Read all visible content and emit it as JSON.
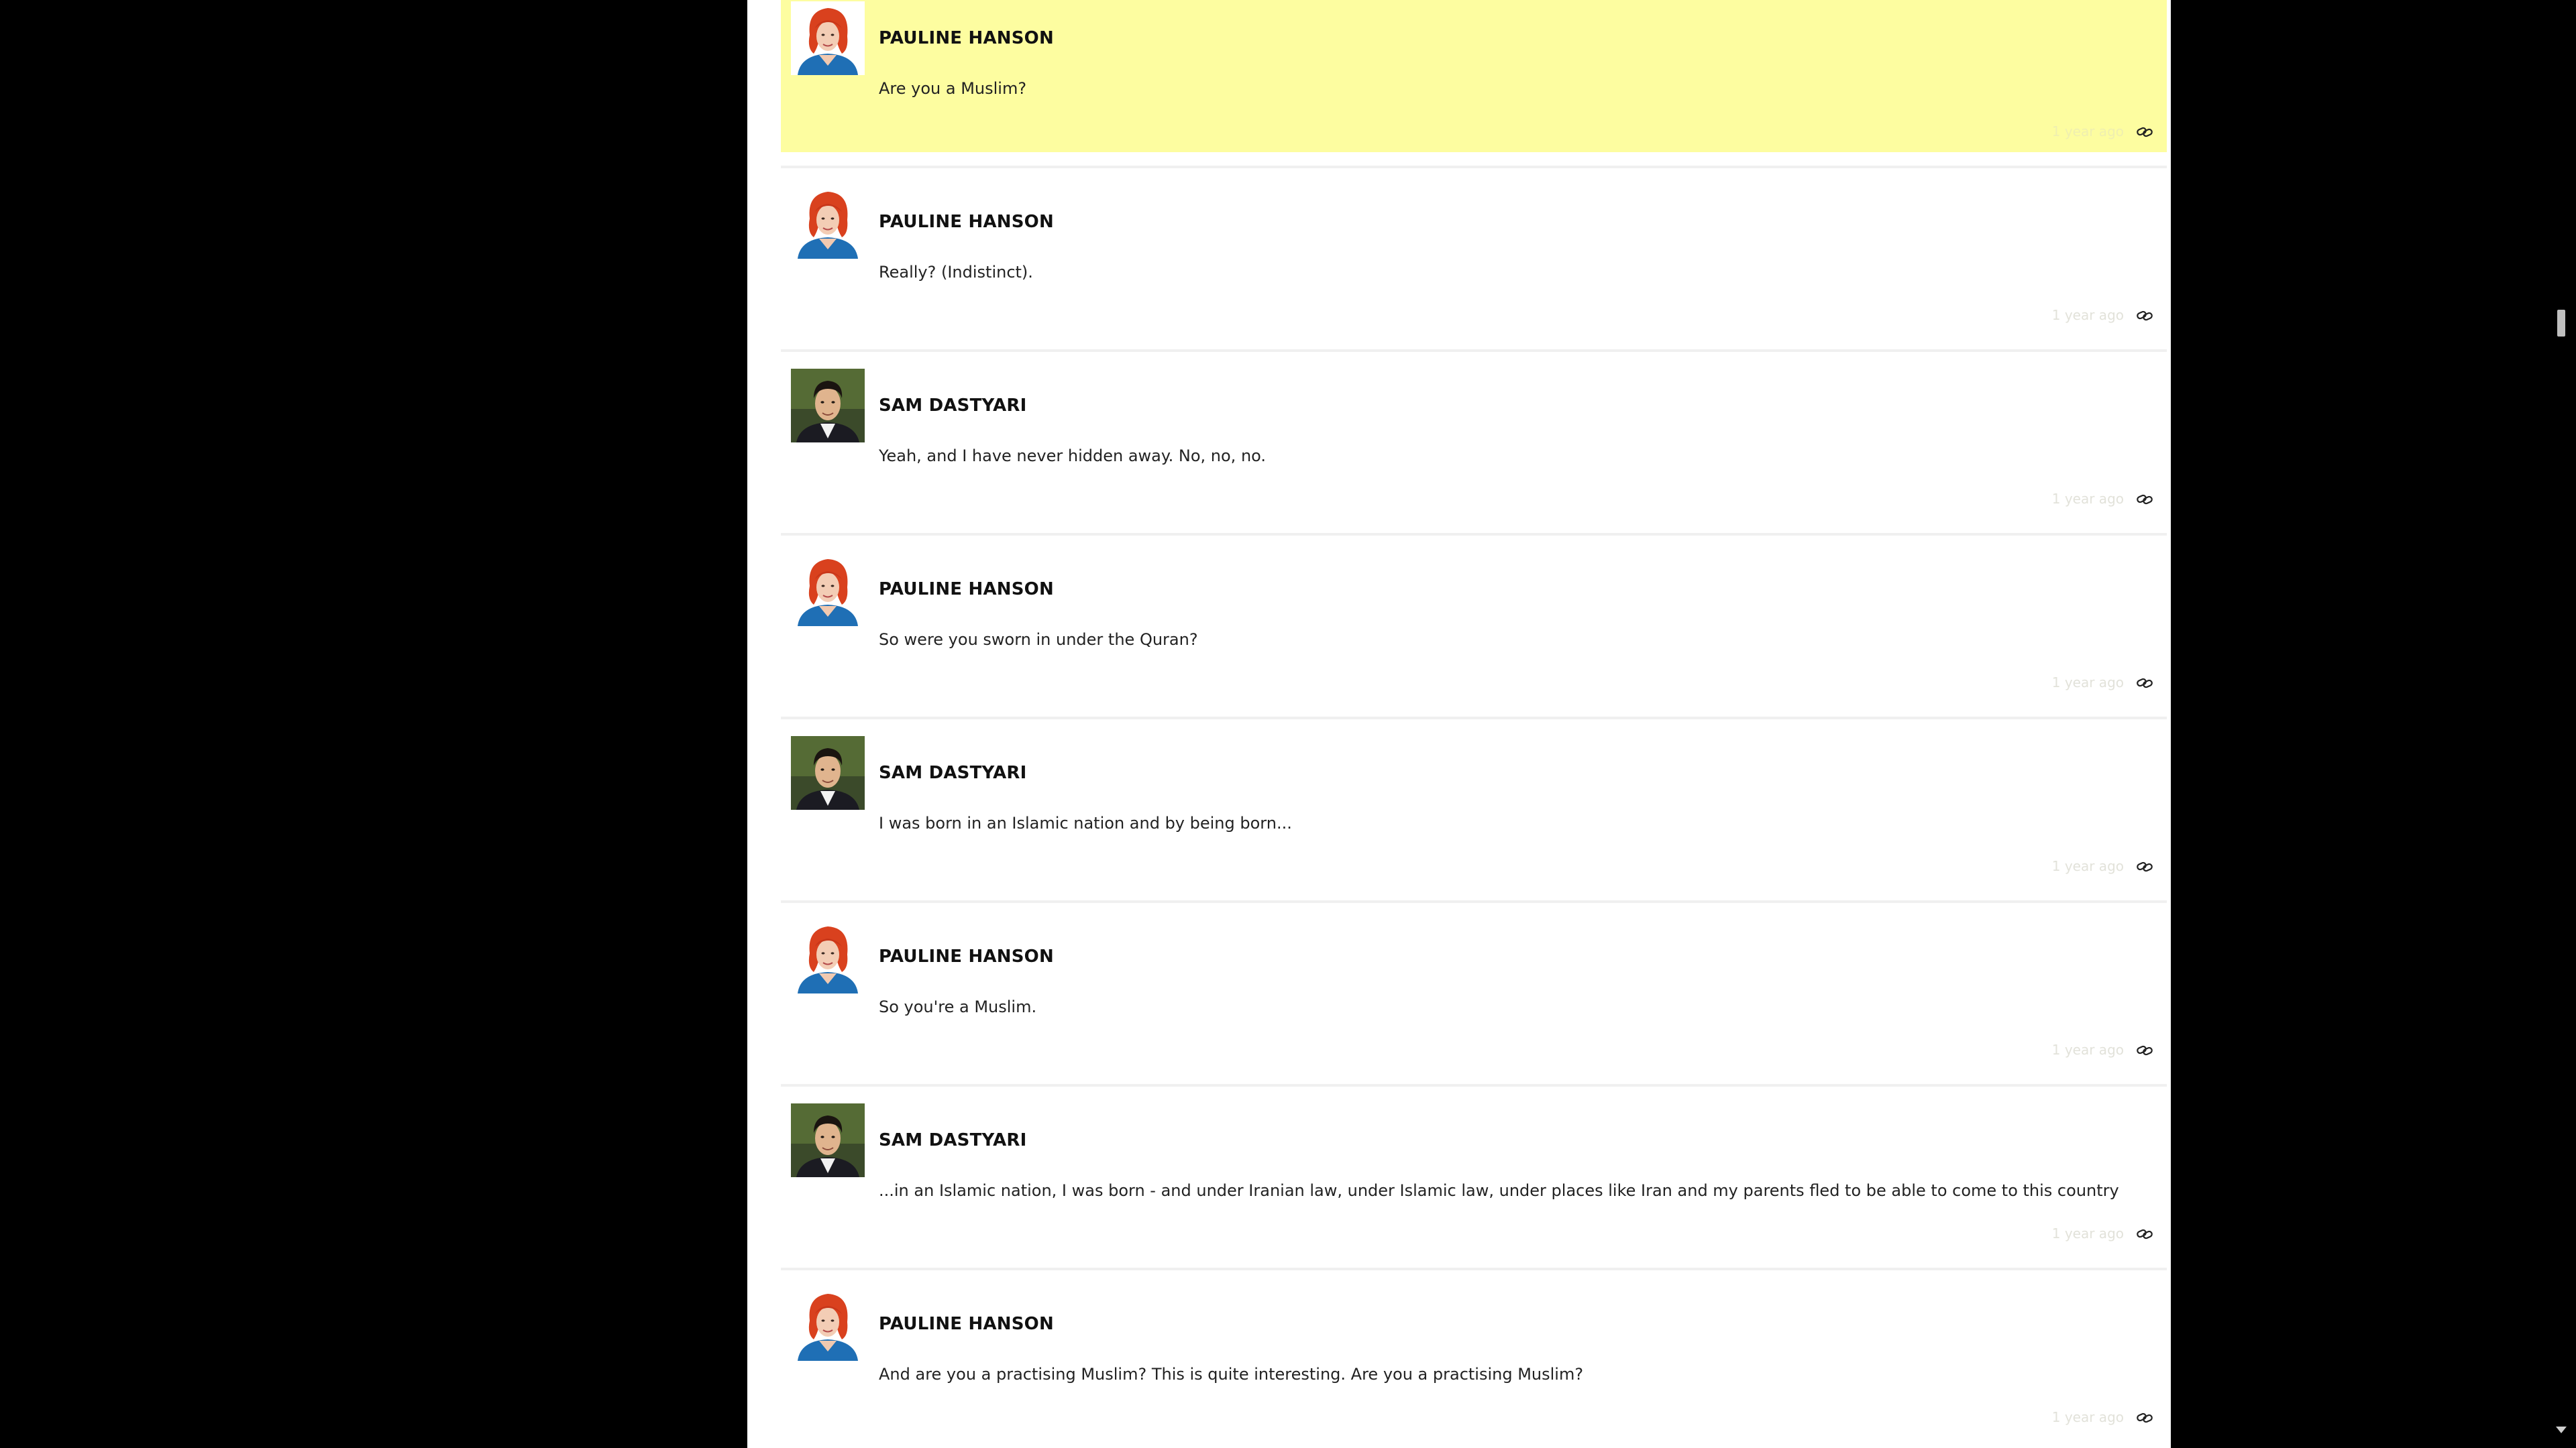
{
  "messages": [
    {
      "speaker": "PAULINE HANSON",
      "avatar": "pauline-hanson-avatar",
      "text": "Are you a Muslim?",
      "time": "1 year ago",
      "highlighted": true
    },
    {
      "speaker": "PAULINE HANSON",
      "avatar": "pauline-hanson-avatar",
      "text": "Really? (Indistinct).",
      "time": "1 year ago",
      "highlighted": false
    },
    {
      "speaker": "SAM DASTYARI",
      "avatar": "sam-dastyari-avatar",
      "text": "Yeah, and I have never hidden away. No, no, no.",
      "time": "1 year ago",
      "highlighted": false
    },
    {
      "speaker": "PAULINE HANSON",
      "avatar": "pauline-hanson-avatar",
      "text": "So were you sworn in under the Quran?",
      "time": "1 year ago",
      "highlighted": false
    },
    {
      "speaker": "SAM DASTYARI",
      "avatar": "sam-dastyari-avatar",
      "text": "I was born in an Islamic nation and by being born...",
      "time": "1 year ago",
      "highlighted": false
    },
    {
      "speaker": "PAULINE HANSON",
      "avatar": "pauline-hanson-avatar",
      "text": "So you're a Muslim.",
      "time": "1 year ago",
      "highlighted": false
    },
    {
      "speaker": "SAM DASTYARI",
      "avatar": "sam-dastyari-avatar",
      "text": "...in an Islamic nation, I was born - and under Iranian law, under Islamic law, under places like Iran and my parents fled to be able to come to this country",
      "time": "1 year ago",
      "highlighted": false
    },
    {
      "speaker": "PAULINE HANSON",
      "avatar": "pauline-hanson-avatar",
      "text": "And are you a practising Muslim? This is quite interesting. Are you a practising Muslim?",
      "time": "1 year ago",
      "highlighted": false
    }
  ],
  "icons": {
    "permalink": "link-icon"
  },
  "colors": {
    "highlight": "#fdfda0",
    "background": "#000000",
    "page": "#ffffff"
  }
}
